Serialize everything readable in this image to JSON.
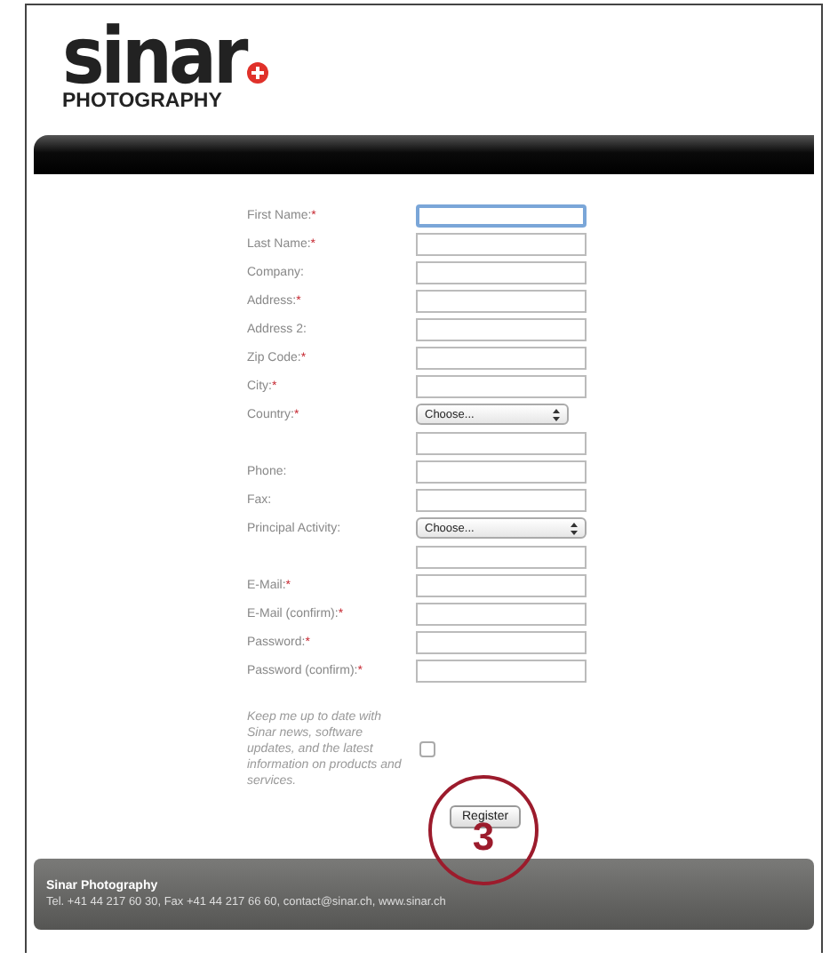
{
  "logo": {
    "name": "sinar",
    "tagline": "PHOTOGRAPHY"
  },
  "form": {
    "fields": [
      {
        "kind": "text",
        "label": "First Name:",
        "mark": "*",
        "focused": true
      },
      {
        "kind": "text",
        "label": "Last Name:",
        "mark": "*",
        "focused": false
      },
      {
        "kind": "text",
        "label": "Company:",
        "focused": false
      },
      {
        "kind": "text",
        "label": "Address:",
        "mark": "*",
        "focused": false
      },
      {
        "kind": "text",
        "label": "Address 2:",
        "focused": false
      },
      {
        "kind": "text",
        "label": "Zip Code:",
        "mark": "*",
        "focused": false
      },
      {
        "kind": "text",
        "label": "City:",
        "mark": "*",
        "focused": false
      },
      {
        "kind": "select",
        "label": "Country:",
        "mark": "*",
        "value": "Choose..."
      },
      {
        "kind": "text",
        "focused": false
      },
      {
        "kind": "text",
        "label": "Phone:",
        "focused": false
      },
      {
        "kind": "text",
        "label": "Fax:",
        "focused": false
      },
      {
        "kind": "select",
        "label": "Principal Activity:",
        "value": "Choose..."
      },
      {
        "kind": "text",
        "focused": false
      },
      {
        "kind": "text",
        "label": "E-Mail:",
        "mark": "*",
        "focused": false
      },
      {
        "kind": "text",
        "label": "E-Mail (confirm):",
        "mark": "*",
        "focused": false
      },
      {
        "kind": "text",
        "label": "Password:",
        "mark": "*",
        "focused": false
      },
      {
        "kind": "text",
        "label": "Password (confirm):",
        "mark": "*",
        "focused": false
      }
    ],
    "newsletter": {
      "label": "Keep me up to date with Sinar news, software updates, and the latest information on products and services.",
      "checked": false
    },
    "submit": "Register"
  },
  "annotation": "3",
  "footer": {
    "title": "Sinar Photography",
    "contact": "Tel. +41 44 217 60 30, Fax +41 44 217 66 60,",
    "email": "contact@sinar.ch,",
    "website": "www.sinar.ch"
  }
}
